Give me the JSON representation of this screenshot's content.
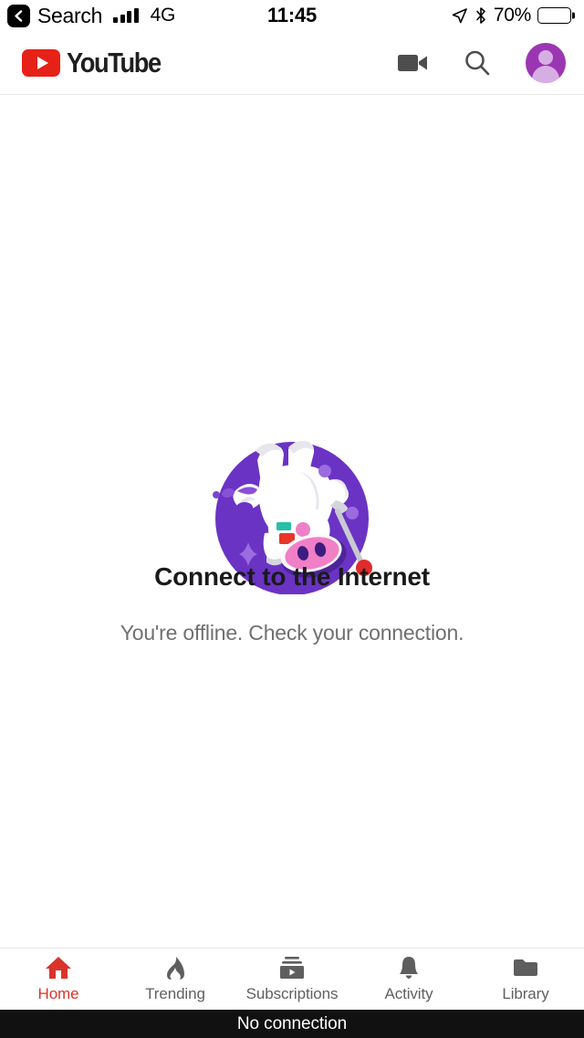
{
  "status_bar": {
    "back_label": "Search",
    "back_icon": "chevron-left-icon",
    "signal_icon": "cellular-signal-icon",
    "network_type": "4G",
    "time": "11:45",
    "location_icon": "location-arrow-icon",
    "bluetooth_icon": "bluetooth-icon",
    "battery_percent": "70%",
    "battery_level": 70,
    "battery_color": "#f7cf46"
  },
  "header": {
    "logo_icon": "youtube-logo-icon",
    "logo_text": "YouTube",
    "brand_color": "#e62117",
    "actions": [
      {
        "name": "camera-icon",
        "label": "Camera"
      },
      {
        "name": "search-icon",
        "label": "Search"
      },
      {
        "name": "avatar",
        "label": "Account"
      }
    ],
    "avatar_color": "#9b36b3"
  },
  "main": {
    "illustration": "offline-astronaut-cow-icon",
    "illustration_colors": {
      "circle": "#6a33c4",
      "cow_body": "#ffffff",
      "cow_shadow": "#e0e0e6",
      "snout": "#f07fc6",
      "snout_shadow": "#4e2499",
      "badge_teal": "#2bbfa4",
      "badge_red": "#e8342a",
      "dot_pink": "#ef7fc6",
      "dot_purple": "#9a6ce0",
      "ball_red": "#e12b2b"
    },
    "title": "Connect to the Internet",
    "subtitle": "You're offline. Check your connection."
  },
  "tab_bar": {
    "active_color": "#d8342a",
    "inactive_color": "#606060",
    "tabs": [
      {
        "label": "Home",
        "icon": "home-icon",
        "active": true
      },
      {
        "label": "Trending",
        "icon": "flame-icon",
        "active": false
      },
      {
        "label": "Subscriptions",
        "icon": "subscriptions-icon",
        "active": false
      },
      {
        "label": "Activity",
        "icon": "bell-icon",
        "active": false
      },
      {
        "label": "Library",
        "icon": "folder-icon",
        "active": false
      }
    ]
  },
  "toast": {
    "message": "No connection"
  }
}
